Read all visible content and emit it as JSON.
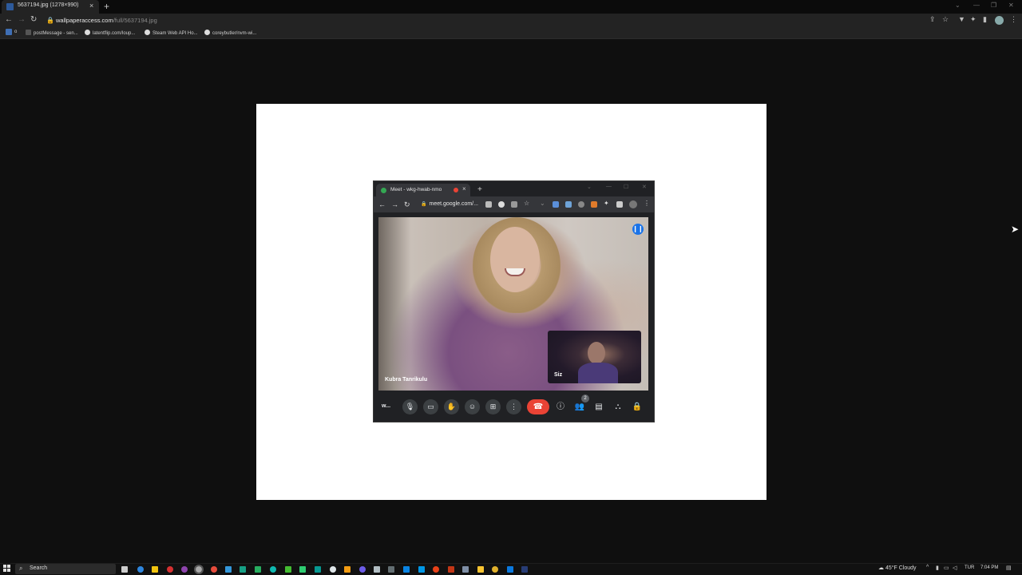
{
  "browser": {
    "tab_title": "5637194.jpg (1278×990)",
    "tab_close": "×",
    "new_tab": "+",
    "url_host": "wallpaperaccess.com",
    "url_path": "/full/5637194.jpg",
    "lock_icon": "🔒",
    "bookmarks": [
      {
        "label": "o"
      },
      {
        "label": "postMessage - sen..."
      },
      {
        "label": "latentflip.com/loup..."
      },
      {
        "label": "Steam Web API Ho..."
      },
      {
        "label": "coreybutler/nvm-wi..."
      }
    ]
  },
  "meet_window": {
    "tab_title": "Meet - wkg-hwab-nmo",
    "tab_close": "×",
    "new_tab": "+",
    "url": "meet.google.com/...",
    "main_speaker_name": "Kubra Tanrikulu",
    "self_label": "Siz",
    "meeting_code_short": "w...",
    "people_count": "2"
  },
  "taskbar": {
    "search_placeholder": "Search",
    "weather": "45°F  Cloudy",
    "language": "TUR",
    "time": "7:04 PM"
  },
  "colors": {
    "meet_end_call": "#ea4335",
    "meet_active_speaker": "#1a73e8",
    "meet_green": "#34a853"
  }
}
